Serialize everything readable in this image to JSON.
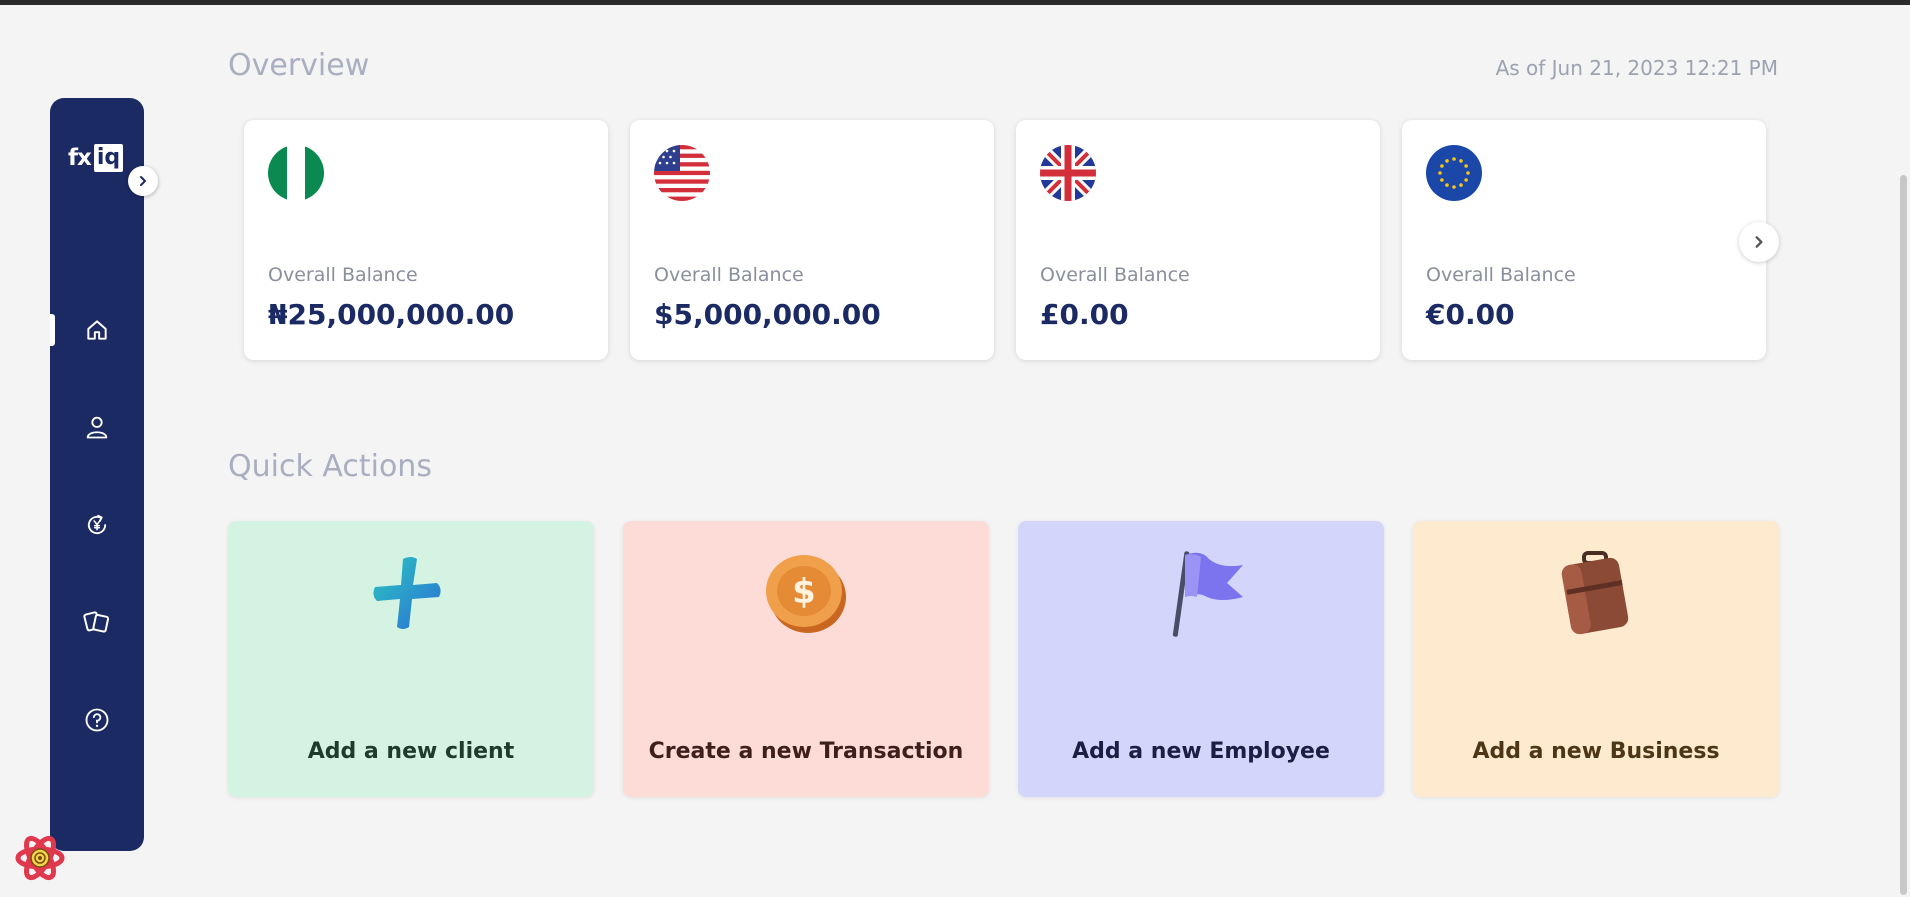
{
  "app": {
    "logo_fx": "fx",
    "logo_iq": "iq"
  },
  "sidebar": {
    "items": [
      {
        "name": "home",
        "icon": "home-icon",
        "active": true
      },
      {
        "name": "user",
        "icon": "user-icon",
        "active": false
      },
      {
        "name": "exchange",
        "icon": "currency-exchange-icon",
        "active": false
      },
      {
        "name": "cards",
        "icon": "cards-icon",
        "active": false
      },
      {
        "name": "help",
        "icon": "help-icon",
        "active": false
      }
    ]
  },
  "overview": {
    "title": "Overview",
    "as_of": "As of Jun 21, 2023 12:21 PM",
    "cards": [
      {
        "flag": "nigeria-flag-icon",
        "label": "Overall Balance",
        "value": "₦25,000,000.00"
      },
      {
        "flag": "usa-flag-icon",
        "label": "Overall Balance",
        "value": "$5,000,000.00"
      },
      {
        "flag": "uk-flag-icon",
        "label": "Overall Balance",
        "value": "£0.00"
      },
      {
        "flag": "eu-flag-icon",
        "label": "Overall Balance",
        "value": "€0.00"
      }
    ]
  },
  "quick_actions": {
    "title": "Quick Actions",
    "items": [
      {
        "label": "Add a new client",
        "icon": "plus-icon",
        "bg": "#d5f3e2",
        "color": "#1f3b2a"
      },
      {
        "label": "Create a new Transaction",
        "icon": "coin-icon",
        "bg": "#fddcd8",
        "color": "#3d1f1c"
      },
      {
        "label": "Add a new Employee",
        "icon": "flag-icon",
        "bg": "#d4d5fb",
        "color": "#1c1f45"
      },
      {
        "label": "Add a new Business",
        "icon": "briefcase-icon",
        "bg": "#feebcf",
        "color": "#4d3616"
      }
    ]
  },
  "colors": {
    "sidebar": "#1b2a63",
    "accent_text": "#1b2a63"
  }
}
